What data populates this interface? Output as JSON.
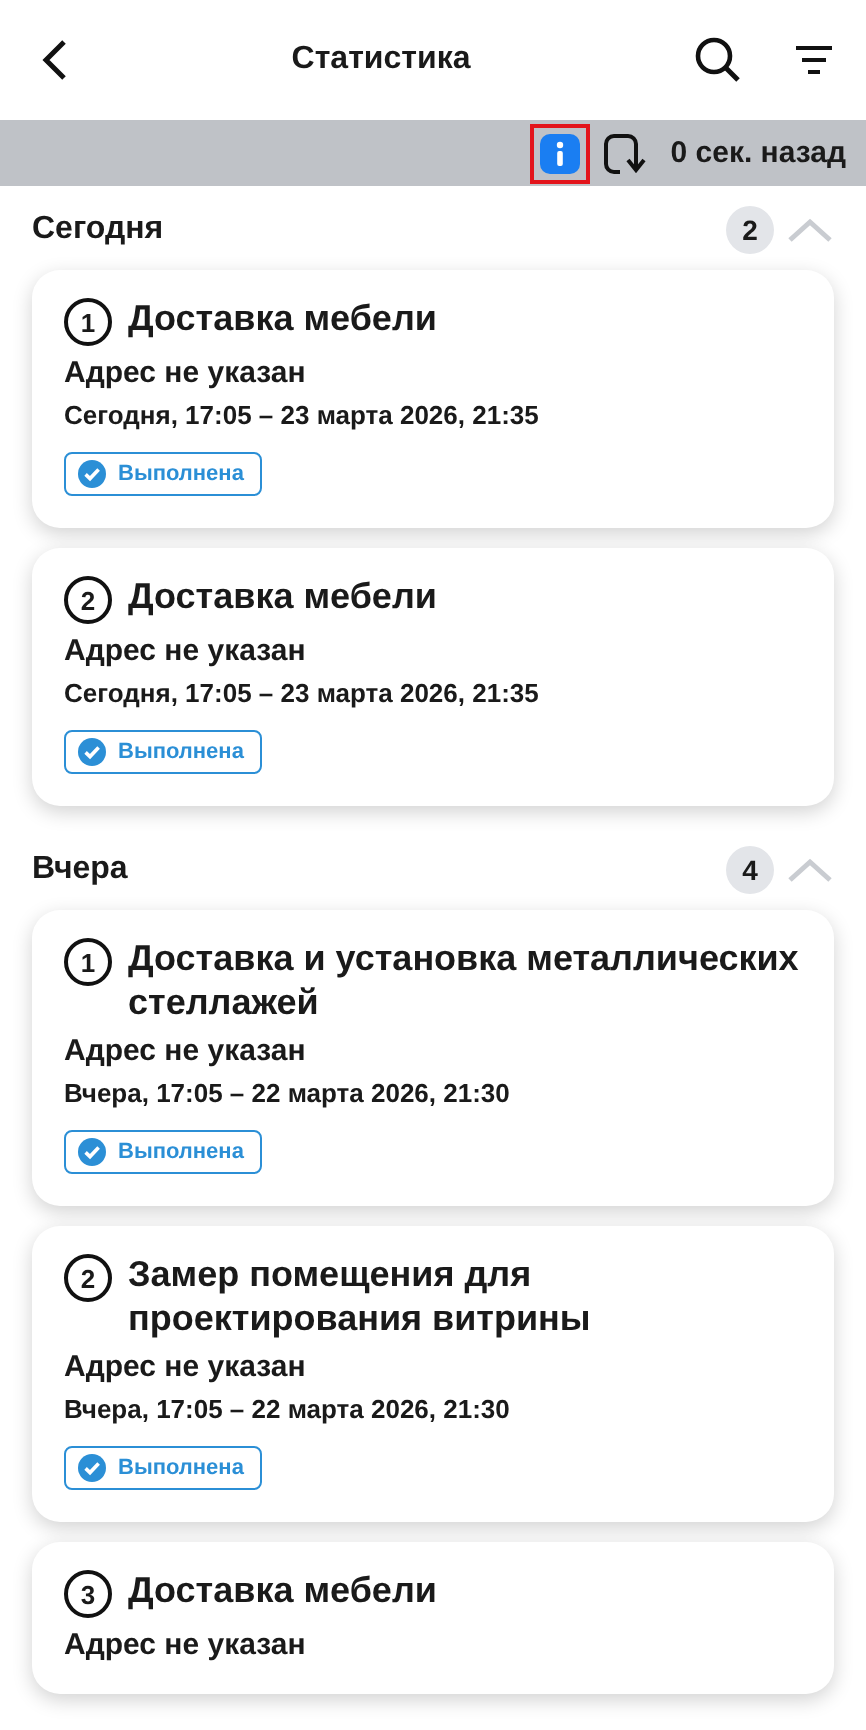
{
  "header": {
    "title": "Статистика"
  },
  "sync_bar": {
    "info_highlighted": true,
    "updated": "0 сек. назад"
  },
  "groups": [
    {
      "title": "Сегодня",
      "count": "2",
      "expanded": true,
      "orders": [
        {
          "number": "1",
          "title": "Доставка мебели",
          "address": "Адрес не указан",
          "period": "Сегодня, 17:05 – 23 марта 2026, 21:35",
          "status": "Выполнена"
        },
        {
          "number": "2",
          "title": "Доставка мебели",
          "address": "Адрес не указан",
          "period": "Сегодня, 17:05 – 23 марта 2026, 21:35",
          "status": "Выполнена"
        }
      ]
    },
    {
      "title": "Вчера",
      "count": "4",
      "expanded": true,
      "orders": [
        {
          "number": "1",
          "title": "Доставка и установка металлических стеллажей",
          "address": "Адрес не указан",
          "period": "Вчера, 17:05 – 22 марта 2026, 21:30",
          "status": "Выполнена"
        },
        {
          "number": "2",
          "title": "Замер помещения для проектирования витрины",
          "address": "Адрес не указан",
          "period": "Вчера, 17:05 – 22 марта 2026, 21:30",
          "status": "Выполнена"
        },
        {
          "number": "3",
          "title": "Доставка мебели",
          "address": "Адрес не указан"
        }
      ]
    }
  ]
}
